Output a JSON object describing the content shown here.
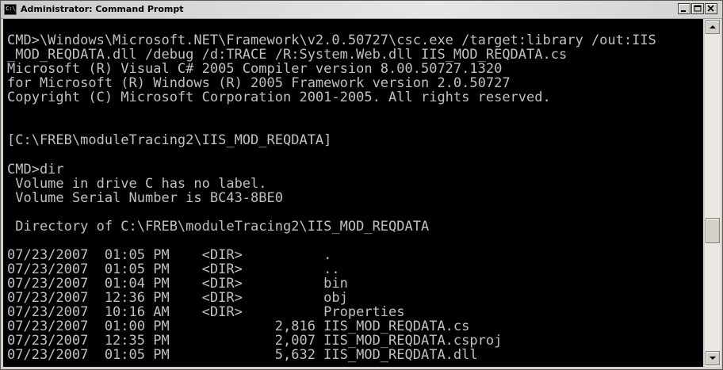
{
  "window": {
    "title": "Administrator: Command Prompt",
    "app_icon_text": "C:\\_"
  },
  "console": {
    "lines": [
      "",
      "CMD>\\Windows\\Microsoft.NET\\Framework\\v2.0.50727\\csc.exe /target:library /out:IIS",
      "_MOD_REQDATA.dll /debug /d:TRACE /R:System.Web.dll IIS_MOD_REQDATA.cs",
      "Microsoft (R) Visual C# 2005 Compiler version 8.00.50727.1320",
      "for Microsoft (R) Windows (R) 2005 Framework version 2.0.50727",
      "Copyright (C) Microsoft Corporation 2001-2005. All rights reserved.",
      "",
      "",
      "[C:\\FREB\\moduleTracing2\\IIS_MOD_REQDATA]",
      "",
      "CMD>dir",
      " Volume in drive C has no label.",
      " Volume Serial Number is BC43-8BE0",
      "",
      " Directory of C:\\FREB\\moduleTracing2\\IIS_MOD_REQDATA",
      "",
      "07/23/2007  01:05 PM    <DIR>          .",
      "07/23/2007  01:05 PM    <DIR>          ..",
      "07/23/2007  01:04 PM    <DIR>          bin",
      "07/23/2007  12:36 PM    <DIR>          obj",
      "07/23/2007  10:16 AM    <DIR>          Properties",
      "07/23/2007  01:00 PM             2,816 IIS_MOD_REQDATA.cs",
      "07/23/2007  12:35 PM             2,007 IIS_MOD_REQDATA.csproj",
      "07/23/2007  01:05 PM             5,632 IIS_MOD_REQDATA.dll"
    ]
  },
  "scrollbar": {
    "position": 0.63
  }
}
